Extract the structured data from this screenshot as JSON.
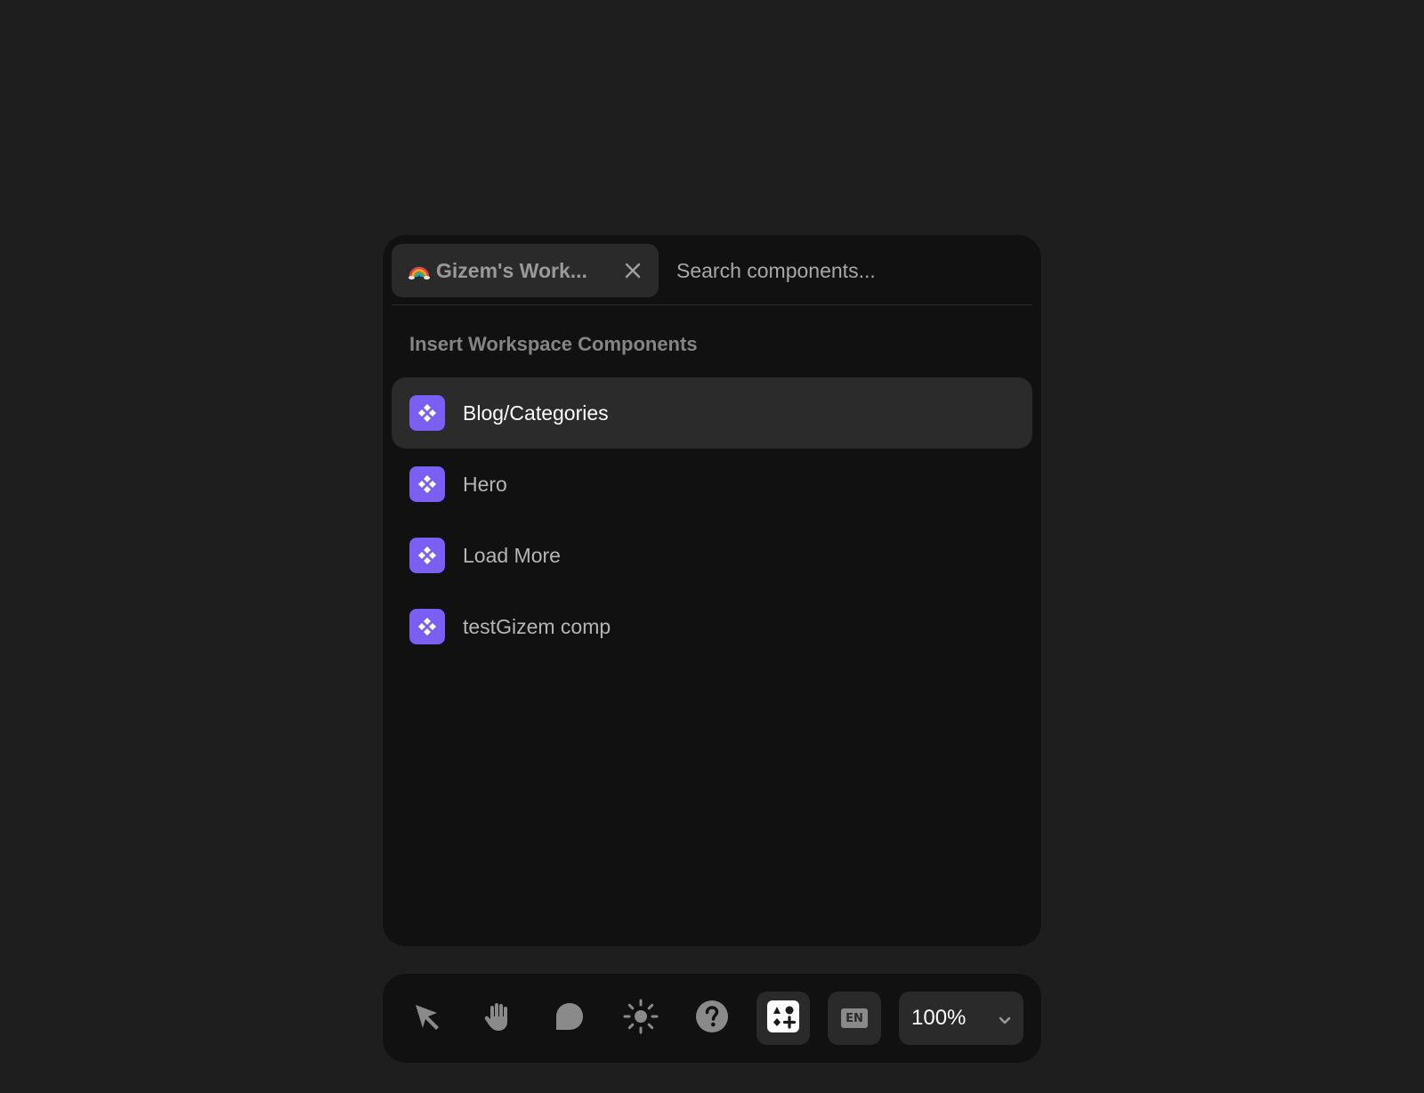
{
  "search": {
    "workspace_chip": "Gizem's Work...",
    "workspace_emoji_icon": "rainbow-icon",
    "placeholder": "Search components..."
  },
  "section": {
    "title": "Insert Workspace Components"
  },
  "components": [
    {
      "label": "Blog/Categories",
      "active": true
    },
    {
      "label": "Hero",
      "active": false
    },
    {
      "label": "Load More",
      "active": false
    },
    {
      "label": "testGizem comp",
      "active": false
    }
  ],
  "toolbar": {
    "tools": [
      "select-tool",
      "hand-tool",
      "comment-tool",
      "theme-toggle",
      "help",
      "insert-component",
      "language"
    ],
    "language": "EN",
    "zoom": "100%"
  },
  "colors": {
    "accent": "#7b5ef2",
    "panel": "#111111",
    "background": "#1e1e1e"
  }
}
